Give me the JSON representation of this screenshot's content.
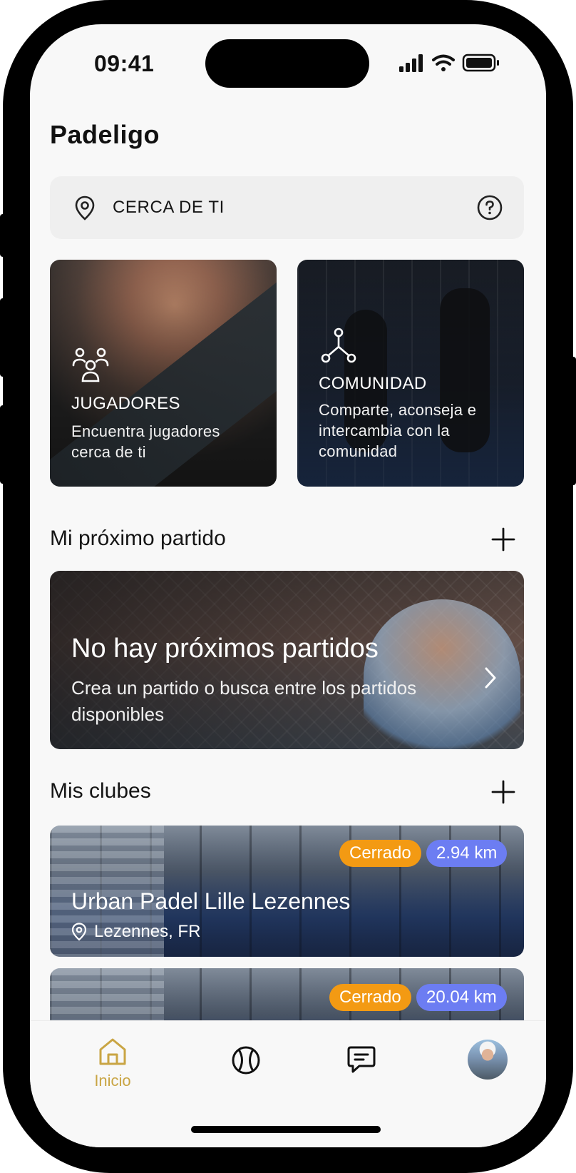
{
  "status_bar": {
    "time": "09:41"
  },
  "app": {
    "logo_text": "Padeligo"
  },
  "location": {
    "label": "CERCA DE TI"
  },
  "features": [
    {
      "title": "JUGADORES",
      "description": "Encuentra jugadores cerca de ti",
      "icon": "users-icon"
    },
    {
      "title": "COMUNIDAD",
      "description": "Comparte, aconseja e intercambia con la comunidad",
      "icon": "network-icon"
    }
  ],
  "next_match": {
    "section_title": "Mi próximo partido",
    "title": "No hay próximos partidos",
    "description": "Crea un partido o busca entre los partidos disponibles"
  },
  "clubs": {
    "section_title": "Mis clubes",
    "items": [
      {
        "name": "Urban Padel Lille Lezennes",
        "location": "Lezennes, FR",
        "status": "Cerrado",
        "distance": "2.94 km"
      },
      {
        "name": "",
        "location": "",
        "status": "Cerrado",
        "distance": "20.04 km"
      }
    ]
  },
  "tabbar": {
    "home_label": "Inicio",
    "active_color": "#c9a544"
  },
  "colors": {
    "badge_closed": "#f39a13",
    "badge_distance": "#6c7df2"
  }
}
